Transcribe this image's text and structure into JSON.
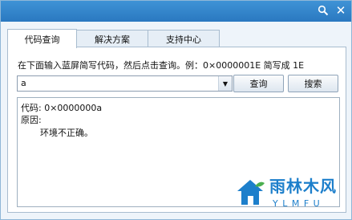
{
  "tabs": [
    {
      "label": "代码查询",
      "active": true
    },
    {
      "label": "解决方案",
      "active": false
    },
    {
      "label": "支持中心",
      "active": false
    }
  ],
  "description": "在下面输入蓝屏简写代码，然后点击查询。例：0×0000001E 简写成 1E",
  "code_input": {
    "value": "a"
  },
  "buttons": {
    "query": "查询",
    "search": "搜索"
  },
  "result": {
    "code_line": "代码: 0×0000000a",
    "reason_label": "原因:",
    "reason_text": "环境不正确。"
  },
  "watermark": {
    "text": "雨林木风",
    "sub": "Y L M F U"
  }
}
